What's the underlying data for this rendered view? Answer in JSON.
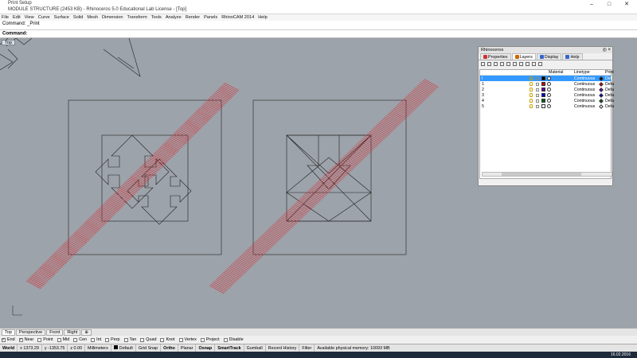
{
  "window": {
    "title": "Print Setup",
    "subtitle": "MODULE STRUCTURE (2453 KB) - Rhinoceros 5.0 Educational Lab License - [Top]",
    "controls": [
      "–",
      "□",
      "✕"
    ]
  },
  "menu": [
    "File",
    "Edit",
    "View",
    "Curve",
    "Surface",
    "Solid",
    "Mesh",
    "Dimension",
    "Transform",
    "Tools",
    "Analyze",
    "Render",
    "Panels",
    "RhinoCAM 2014",
    "Help"
  ],
  "command": {
    "history": "Command: _Print",
    "prompt": "Command:",
    "value": ""
  },
  "viewport": {
    "label": "Top"
  },
  "layers_panel": {
    "title": "Rhinoceros",
    "title_buttons": "◎ ×",
    "tabs": [
      {
        "label": "Properties",
        "icon": "properties-icon",
        "color": "#cc3333"
      },
      {
        "label": "Layers",
        "icon": "layers-icon",
        "color": "#cc6600"
      },
      {
        "label": "Display",
        "icon": "display-icon",
        "color": "#3366cc"
      },
      {
        "label": "Help",
        "icon": "help-icon",
        "color": "#3366cc"
      }
    ],
    "headers": {
      "material": "Material",
      "linetype": "Linetype",
      "print": "Print"
    },
    "rows": [
      {
        "name": "I",
        "color": "#000000",
        "linetype": "Continuous",
        "print_color": "#000000",
        "print": "Def",
        "selected": true
      },
      {
        "name": "1",
        "color": "#cc0000",
        "linetype": "Continuous",
        "print_color": "#cc0000",
        "print": "Defa",
        "selected": false
      },
      {
        "name": "2",
        "color": "#660099",
        "linetype": "Continuous",
        "print_color": "#660099",
        "print": "Defa",
        "selected": false
      },
      {
        "name": "3",
        "color": "#0000cc",
        "linetype": "Continuous",
        "print_color": "#0000cc",
        "print": "Defa",
        "selected": false
      },
      {
        "name": "4",
        "color": "#006600",
        "linetype": "Continuous",
        "print_color": "#006600",
        "print": "Defa",
        "selected": false
      },
      {
        "name": "5",
        "color": "#ffffff",
        "linetype": "Continuous",
        "print_color": "#ffffff",
        "print": "Defa",
        "selected": false
      }
    ]
  },
  "viewport_tabs": [
    "Top",
    "Perspective",
    "Front",
    "Right",
    "⊕"
  ],
  "osnaps": [
    {
      "label": "End",
      "checked": true
    },
    {
      "label": "Near",
      "checked": true
    },
    {
      "label": "Point",
      "checked": false
    },
    {
      "label": "Mid",
      "checked": false
    },
    {
      "label": "Cen",
      "checked": false
    },
    {
      "label": "Int",
      "checked": false
    },
    {
      "label": "Perp",
      "checked": false
    },
    {
      "label": "Tan",
      "checked": false
    },
    {
      "label": "Quad",
      "checked": false
    },
    {
      "label": "Knot",
      "checked": false
    },
    {
      "label": "Vertex",
      "checked": false
    },
    {
      "label": "Project",
      "checked": false
    },
    {
      "label": "Disable",
      "checked": false
    }
  ],
  "status": {
    "cplane": "World",
    "x": "x 1373.29",
    "y": "y -1353.75",
    "z": "z 0.00",
    "units": "Millimeters",
    "layer": "Default",
    "grid_snap": "Grid Snap",
    "ortho": "Ortho",
    "planar": "Planar",
    "osnap": "Osnap",
    "smarttrack": "SmartTrack",
    "gumball": "Gumball",
    "record_history": "Record History",
    "filter": "Filter",
    "memory": "Available physical memory: 10093 MB"
  },
  "taskbar": {
    "date": "16.02.2016"
  }
}
